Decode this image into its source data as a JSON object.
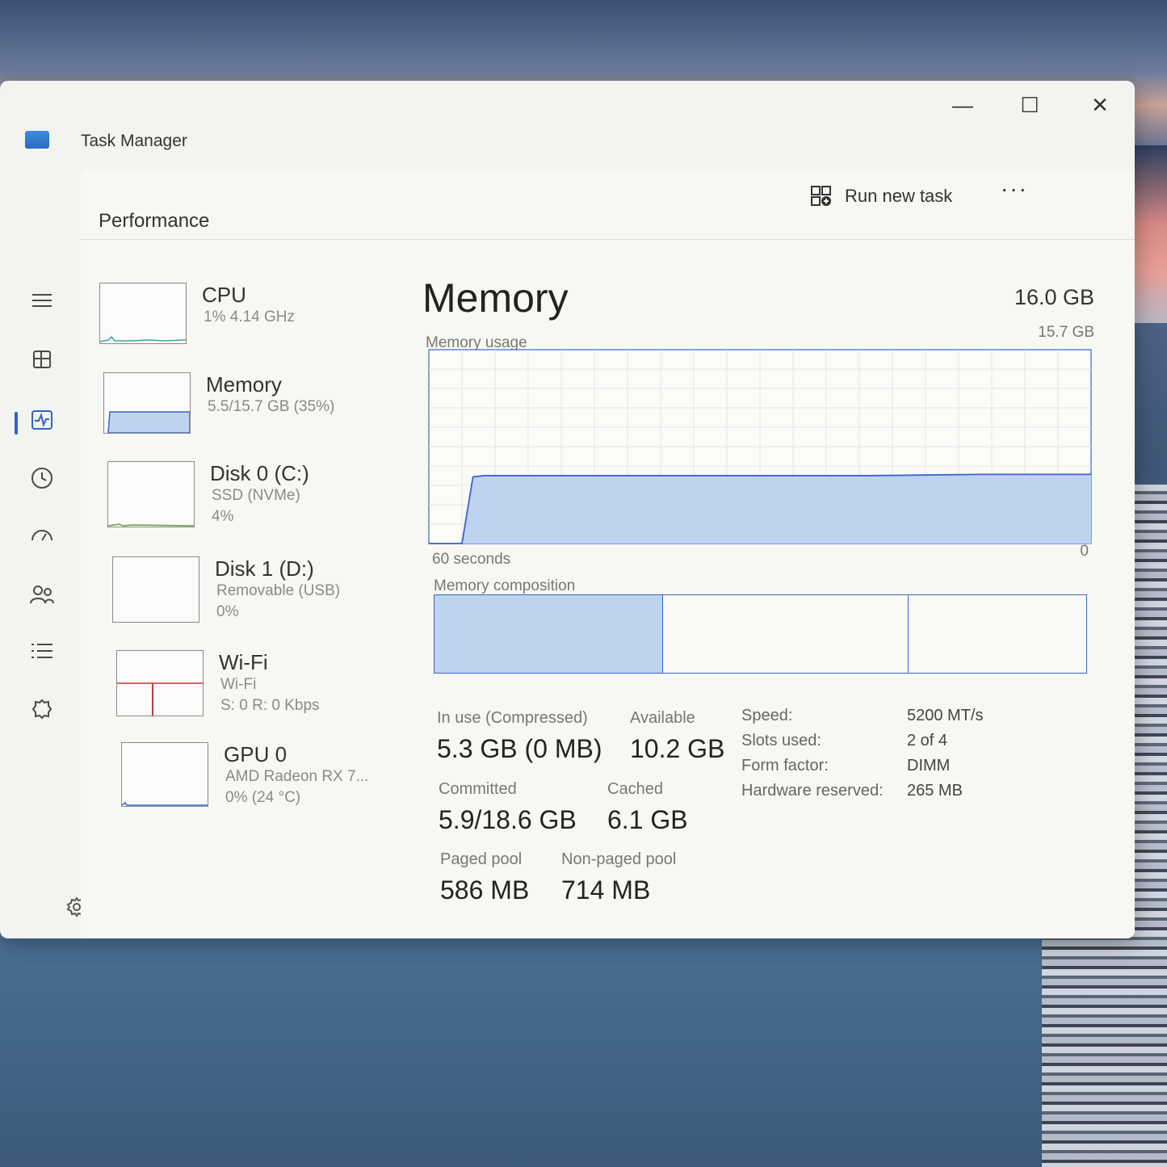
{
  "app": {
    "title": "Task Manager",
    "accent": "#2b67c6"
  },
  "window_controls": {
    "minimize": "—",
    "maximize": "☐",
    "close": "✕"
  },
  "nav_icons": [
    "hamburger-icon",
    "processes-icon",
    "performance-icon",
    "app-history-icon",
    "startup-apps-icon",
    "users-icon",
    "details-icon",
    "services-icon",
    "settings-icon"
  ],
  "header": {
    "title": "Performance",
    "run_new_task": "Run new task",
    "more": "···"
  },
  "devices": [
    {
      "name": "CPU",
      "sub1": "1% 4.14 GHz",
      "sub2": ""
    },
    {
      "name": "Memory",
      "sub1": "5.5/15.7 GB (35%)",
      "sub2": ""
    },
    {
      "name": "Disk 0 (C:)",
      "sub1": "SSD (NVMe)",
      "sub2": "4%"
    },
    {
      "name": "Disk 1 (D:)",
      "sub1": "Removable (USB)",
      "sub2": "0%"
    },
    {
      "name": "Wi-Fi",
      "sub1": "Wi-Fi",
      "sub2": "S: 0 R: 0 Kbps"
    },
    {
      "name": "GPU 0",
      "sub1": "AMD Radeon RX 7...",
      "sub2": "0% (24 °C)"
    }
  ],
  "memory": {
    "title": "Memory",
    "total": "16.0 GB",
    "usage_label": "Memory usage",
    "usage_max": "15.7 GB",
    "axis_left": "60 seconds",
    "axis_right": "0",
    "composition_label": "Memory composition",
    "composition_fraction": {
      "in_use": 0.335,
      "modified": 0.015,
      "standby": 0.376,
      "free": 0.274
    },
    "stats": {
      "in_use_label": "In use (Compressed)",
      "in_use_value": "5.3 GB (0 MB)",
      "available_label": "Available",
      "available_value": "10.2 GB",
      "committed_label": "Committed",
      "committed_value": "5.9/18.6 GB",
      "cached_label": "Cached",
      "cached_value": "6.1 GB",
      "paged_pool_label": "Paged pool",
      "paged_pool_value": "586 MB",
      "nonpaged_pool_label": "Non-paged pool",
      "nonpaged_pool_value": "714 MB"
    },
    "specs": [
      {
        "key": "Speed:",
        "value": "5200 MT/s"
      },
      {
        "key": "Slots used:",
        "value": "2 of 4"
      },
      {
        "key": "Form factor:",
        "value": "DIMM"
      },
      {
        "key": "Hardware reserved:",
        "value": "265 MB"
      }
    ]
  },
  "chart_data": {
    "type": "area",
    "xlabel": "60 seconds",
    "x": [
      60,
      58,
      57,
      56,
      55,
      50,
      40,
      30,
      20,
      10,
      5,
      0
    ],
    "values": [
      0,
      0,
      0,
      5.4,
      5.5,
      5.5,
      5.5,
      5.5,
      5.5,
      5.6,
      5.6,
      5.6
    ],
    "ylim": [
      0,
      15.7
    ],
    "grid": true,
    "colors": {
      "fill": "#bdd3f0",
      "line": "#3a66c7",
      "grid": "#e3e6ea"
    }
  }
}
